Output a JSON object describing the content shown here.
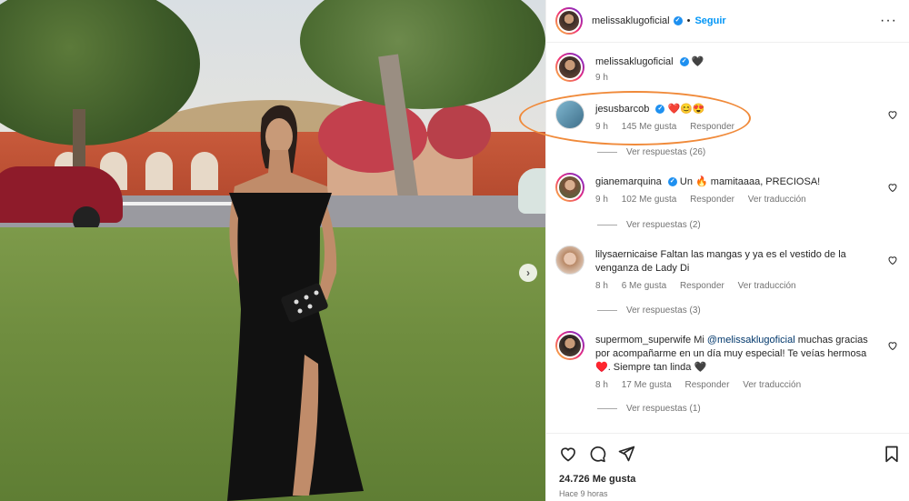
{
  "post": {
    "author": "melissaklugoficial",
    "follow_label": "Seguir",
    "separator": "•",
    "caption_emoji": "🖤",
    "caption_time": "9 h"
  },
  "comments": [
    {
      "user": "jesusbarcob",
      "verified": true,
      "text": "❤️😊😍",
      "time": "9 h",
      "likes": "145 Me gusta",
      "reply_label": "Responder",
      "translate_label": "",
      "view_replies": "Ver respuestas (26)"
    },
    {
      "user": "gianemarquina",
      "verified": true,
      "text": "Un 🔥 mamitaaaa, PRECIOSA!",
      "time": "9 h",
      "likes": "102 Me gusta",
      "reply_label": "Responder",
      "translate_label": "Ver traducción",
      "view_replies": "Ver respuestas (2)"
    },
    {
      "user": "lilysaernicaise",
      "verified": false,
      "text": "Faltan las mangas y ya es el vestido de la venganza de Lady Di",
      "time": "8 h",
      "likes": "6 Me gusta",
      "reply_label": "Responder",
      "translate_label": "Ver traducción",
      "view_replies": "Ver respuestas (3)"
    },
    {
      "user": "supermom_superwife",
      "verified": false,
      "text_before": "Mi",
      "mention": "@melissaklugoficial",
      "text_after": "muchas gracias por acompañarme en un día muy especial! Te veías hermosa ♥️. Siempre tan linda 🖤",
      "time": "8 h",
      "likes": "17 Me gusta",
      "reply_label": "Responder",
      "translate_label": "Ver traducción",
      "view_replies": "Ver respuestas (1)"
    }
  ],
  "footer": {
    "likes": "24.726 Me gusta",
    "time_ago": "Hace 9 horas"
  },
  "icons": {
    "like": "heart-icon",
    "comment": "comment-icon",
    "share": "share-icon",
    "save": "bookmark-icon",
    "more": "more-options-icon",
    "next": "chevron-right-icon"
  },
  "colors": {
    "link": "#0095f6",
    "verified": "#1e90f0",
    "annotation": "#f08a3a",
    "muted": "#737373"
  }
}
